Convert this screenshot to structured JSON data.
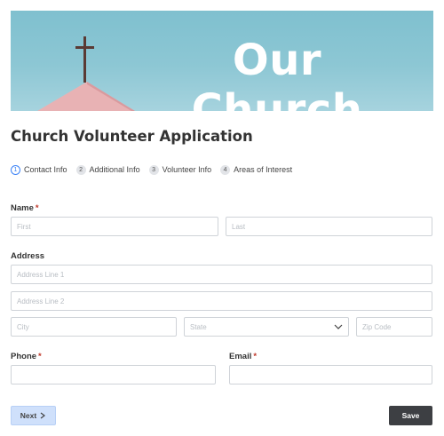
{
  "banner": {
    "title": "Our Church"
  },
  "form": {
    "title": "Church Volunteer Application",
    "steps": [
      {
        "num": "1",
        "label": "Contact Info"
      },
      {
        "num": "2",
        "label": "Additional Info"
      },
      {
        "num": "3",
        "label": "Volunteer Info"
      },
      {
        "num": "4",
        "label": "Areas of Interest"
      }
    ],
    "fields": {
      "name": {
        "label": "Name",
        "required": "*",
        "first_placeholder": "First",
        "last_placeholder": "Last"
      },
      "address": {
        "label": "Address",
        "line1_placeholder": "Address Line 1",
        "line2_placeholder": "Address Line 2",
        "city_placeholder": "City",
        "state_placeholder": "State",
        "zip_placeholder": "Zip Code"
      },
      "phone": {
        "label": "Phone",
        "required": "*"
      },
      "email": {
        "label": "Email",
        "required": "*"
      }
    },
    "buttons": {
      "next": "Next",
      "save": "Save"
    }
  },
  "colors": {
    "accent": "#3b82f6",
    "required": "#c0392b",
    "banner": "#8dc7d4",
    "save_bg": "#3d3f43"
  },
  "icons": [
    "cross-icon",
    "chevron-down-icon",
    "chevron-right-icon"
  ]
}
